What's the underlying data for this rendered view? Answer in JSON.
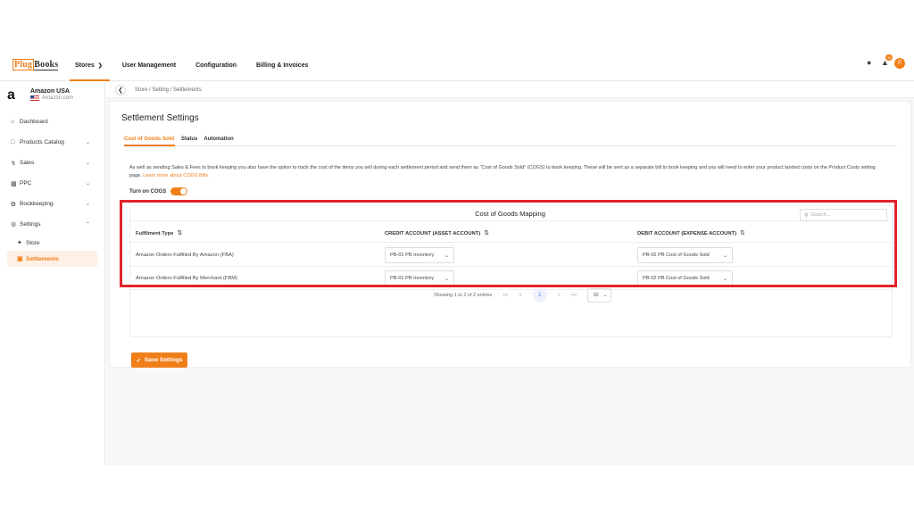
{
  "topbar": {
    "logo_part1": "Plug",
    "logo_part2": "Books",
    "nav": [
      {
        "label": "Stores",
        "has_chevron": true
      },
      {
        "label": "User Management"
      },
      {
        "label": "Configuration"
      },
      {
        "label": "Billing & Invoices"
      }
    ],
    "notification_count": "10",
    "avatar_initial": "P"
  },
  "sidebar": {
    "store_logo": "a",
    "store_name": "Amazon USA",
    "store_domain": "Amazon.com",
    "items": [
      {
        "label": "Dashboard",
        "icon": "home-icon"
      },
      {
        "label": "Products Catalog",
        "icon": "catalog-icon"
      },
      {
        "label": "Sales",
        "icon": "chart-icon"
      },
      {
        "label": "PPC",
        "icon": "ppc-icon"
      },
      {
        "label": "Bookkeeping",
        "icon": "bookkeeping-icon"
      },
      {
        "label": "Settings",
        "icon": "gear-icon"
      }
    ],
    "sub_items": [
      {
        "label": "Store"
      },
      {
        "label": "Settlements",
        "active": true
      }
    ]
  },
  "breadcrumb": "Store  /  Setting  /  Settlements",
  "page": {
    "title": "Settlement Settings",
    "tabs": [
      "Cost of Goods Sold",
      "Status",
      "Automation"
    ],
    "description": "As well as sending Sales & Fees to book keeping you also have the option to track the cost of the items you sell during each settlement period and send them as \"Cost of Goods Sold\" (COGS) to book keeping. These will be sent as a separate bill to book keeping and you will need to enter your product landed costs on the Product Costs setting page.",
    "description_link": "Learn more about COGS Bills.",
    "toggle_label": "Turn on COGS",
    "toggle_on": true,
    "save_label": "Save Settings"
  },
  "mapping": {
    "title": "Cost of Goods Mapping",
    "search_placeholder": "Search...",
    "columns": [
      "Fulfilment Type",
      "CREDIT ACCOUNT (ASSET ACCOUNT)",
      "DEBIT ACCOUNT (EXPENSE ACCOUNT)"
    ],
    "rows": [
      {
        "type": "Amazon Orders Fulfilled By Amazon (FBA)",
        "credit": "PB-01 PB Inventory",
        "debit": "PB-02 PB Cost of Goods Sold"
      },
      {
        "type": "Amazon Orders Fulfilled By Merchant (FBM)",
        "credit": "PB-01 PB Inventory",
        "debit": "PB-02 PB Cost of Goods Sold"
      }
    ],
    "pagination": {
      "summary": "Showing 1 to 2 of 2 entries",
      "first": "<<",
      "prev": "<",
      "current": "1",
      "next": ">",
      "last": ">>",
      "page_size": "10"
    }
  },
  "colors": {
    "accent": "#f07f1a",
    "highlight": "#e2232a"
  }
}
